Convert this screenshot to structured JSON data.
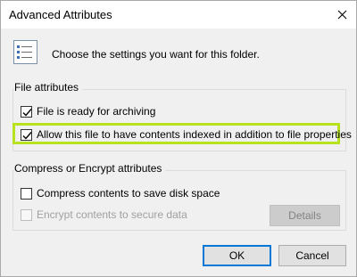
{
  "window": {
    "title": "Advanced Attributes"
  },
  "header": {
    "text": "Choose the settings you want for this folder.",
    "icon": "attributes-list-icon"
  },
  "file_attributes": {
    "label": "File attributes",
    "archive_label": "File is ready for archiving",
    "archive_checked": true,
    "index_label": "Allow this file to have contents indexed in addition to file properties",
    "index_checked": true,
    "highlight_color": "#b7e21d"
  },
  "compress_encrypt": {
    "label": "Compress or Encrypt attributes",
    "compress_label": "Compress contents to save disk space",
    "compress_checked": false,
    "encrypt_label": "Encrypt contents to secure data",
    "encrypt_checked": false,
    "encrypt_enabled": false,
    "details_label": "Details",
    "details_enabled": false
  },
  "buttons": {
    "ok": "OK",
    "cancel": "Cancel"
  }
}
